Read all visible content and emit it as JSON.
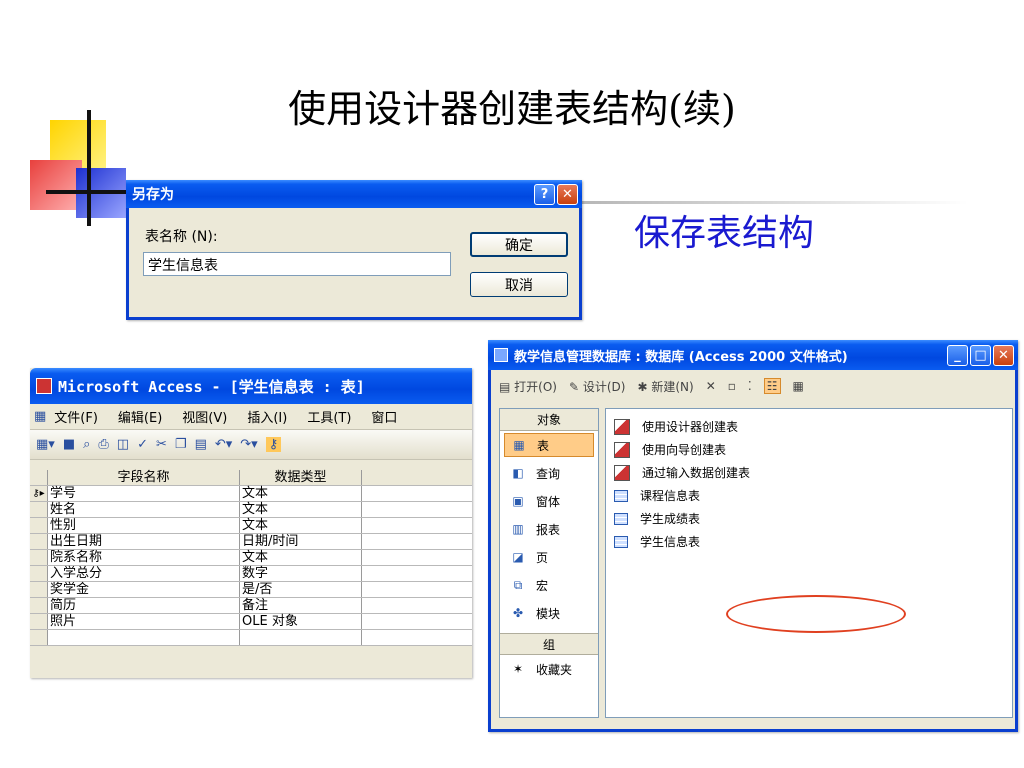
{
  "slide": {
    "title": "使用设计器创建表结构(续)",
    "subtitle": "保存表结构"
  },
  "save_dialog": {
    "title": "另存为",
    "help_glyph": "?",
    "close_glyph": "✕",
    "label": "表名称 (N):",
    "input_value": "学生信息表",
    "ok_label": "确定",
    "cancel_label": "取消"
  },
  "table_window": {
    "title": "Microsoft Access - [学生信息表 : 表]",
    "menu": [
      "文件(F)",
      "编辑(E)",
      "视图(V)",
      "插入(I)",
      "工具(T)",
      "窗口"
    ],
    "toolbar_icons": [
      "view-icon",
      "save-icon",
      "search-icon",
      "print-icon",
      "preview-icon",
      "spell-icon",
      "cut-icon",
      "copy-icon",
      "paste-icon",
      "undo-icon",
      "redo-icon",
      "key-icon"
    ],
    "columns": [
      "字段名称",
      "数据类型"
    ],
    "rows": [
      {
        "name": "学号",
        "type": "文本",
        "key": true
      },
      {
        "name": "姓名",
        "type": "文本",
        "key": false
      },
      {
        "name": "性别",
        "type": "文本",
        "key": false
      },
      {
        "name": "出生日期",
        "type": "日期/时间",
        "key": false
      },
      {
        "name": "院系名称",
        "type": "文本",
        "key": false
      },
      {
        "name": "入学总分",
        "type": "数字",
        "key": false
      },
      {
        "name": "奖学金",
        "type": "是/否",
        "key": false
      },
      {
        "name": "简历",
        "type": "备注",
        "key": false
      },
      {
        "name": "照片",
        "type": "OLE 对象",
        "key": false
      }
    ]
  },
  "db_window": {
    "title": "教学信息管理数据库 : 数据库 (Access 2000 文件格式)",
    "toolbar": {
      "open": "打开(O)",
      "design": "设计(D)",
      "new": "新建(N)"
    },
    "objects_header": "对象",
    "objects": [
      {
        "label": "表",
        "icon": "table-icon",
        "active": true
      },
      {
        "label": "查询",
        "icon": "query-icon",
        "active": false
      },
      {
        "label": "窗体",
        "icon": "form-icon",
        "active": false
      },
      {
        "label": "报表",
        "icon": "report-icon",
        "active": false
      },
      {
        "label": "页",
        "icon": "page-icon",
        "active": false
      },
      {
        "label": "宏",
        "icon": "macro-icon",
        "active": false
      },
      {
        "label": "模块",
        "icon": "module-icon",
        "active": false
      }
    ],
    "groups_header": "组",
    "favorites": "收藏夹",
    "items": [
      {
        "label": "使用设计器创建表",
        "kind": "wizard"
      },
      {
        "label": "使用向导创建表",
        "kind": "wizard"
      },
      {
        "label": "通过输入数据创建表",
        "kind": "wizard"
      },
      {
        "label": "课程信息表",
        "kind": "table"
      },
      {
        "label": "学生成绩表",
        "kind": "table"
      },
      {
        "label": "学生信息表",
        "kind": "table"
      }
    ]
  },
  "colors": {
    "xp_title_blue": "#0048e0",
    "subtitle_blue": "#1a1ad0",
    "highlight_oval": "#e04020",
    "active_object": "#ffcc88"
  }
}
